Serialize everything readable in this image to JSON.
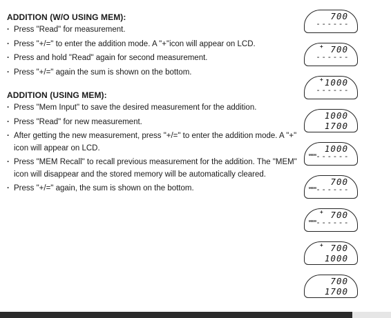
{
  "section1": {
    "heading": "ADDITION (W/O USING MEM):",
    "steps": [
      "Press \"Read\" for measurement.",
      "Press \"+/=\" to enter the addition mode. A \"+\"icon will appear on LCD.",
      "Press and hold \"Read\" again for second measurement.",
      "Press \"+/=\" again the sum is shown on the bottom."
    ]
  },
  "section2": {
    "heading": "ADDITION (USING MEM):",
    "steps": [
      "Press \"Mem Input\" to save the desired measurement for the addition.",
      "Press \"Read\" for new measurement.",
      "After getting the new measurement, press \"+/=\" to enter the addition mode. A \"+\" icon will appear on LCD.",
      "Press \"MEM Recall\" to recall previous measurement for the addition. The \"MEM\" icon will disappear and the stored memory will be automatically cleared.",
      "Press \"+/=\" again, the sum is shown on the bottom."
    ]
  },
  "lcd_displays": [
    {
      "top": "700",
      "bottom": "------",
      "plus": "",
      "mem": ""
    },
    {
      "top": "700",
      "bottom": "------",
      "plus": "+",
      "mem": ""
    },
    {
      "top": "1000",
      "bottom": "------",
      "plus": "+",
      "mem": ""
    },
    {
      "top": "1000",
      "bottom": "1700",
      "plus": "",
      "mem": ""
    },
    {
      "top": "1000",
      "bottom": "------",
      "plus": "",
      "mem": "MEM"
    },
    {
      "top": "700",
      "bottom": "------",
      "plus": "",
      "mem": "MEM"
    },
    {
      "top": "700",
      "bottom": "------",
      "plus": "+",
      "mem": "MEM"
    },
    {
      "top": "700",
      "bottom": "1000",
      "plus": "+",
      "mem": ""
    },
    {
      "top": "700",
      "bottom": "1700",
      "plus": "",
      "mem": ""
    }
  ]
}
